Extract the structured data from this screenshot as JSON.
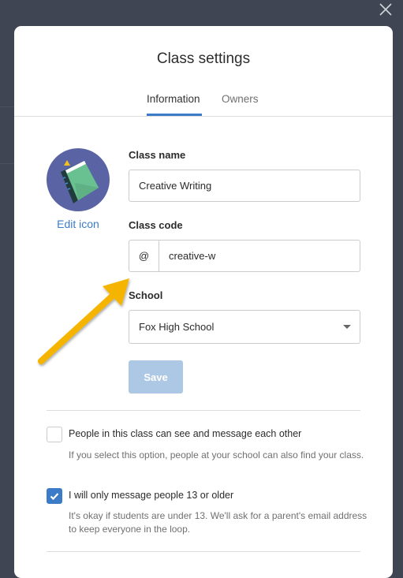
{
  "modal": {
    "title": "Class settings",
    "tabs": [
      {
        "label": "Information",
        "active": true
      },
      {
        "label": "Owners",
        "active": false
      }
    ],
    "edit_icon_label": "Edit icon",
    "class_name": {
      "label": "Class name",
      "value": "Creative Writing"
    },
    "class_code": {
      "label": "Class code",
      "prefix": "@",
      "value": "creative-w"
    },
    "school": {
      "label": "School",
      "value": "Fox High School"
    },
    "save_label": "Save",
    "options": [
      {
        "label": "People in this class can see and message each other",
        "description": "If you select this option, people at your school can also find your class.",
        "checked": false
      },
      {
        "label": "I will only message people 13 or older",
        "description": "It's okay if students are under 13. We'll ask for a parent's email address to keep everyone in the loop.",
        "checked": true
      }
    ]
  },
  "colors": {
    "accent": "#3b7bc8",
    "annotation_arrow": "#f5b400",
    "overlay": "#3f4553"
  }
}
